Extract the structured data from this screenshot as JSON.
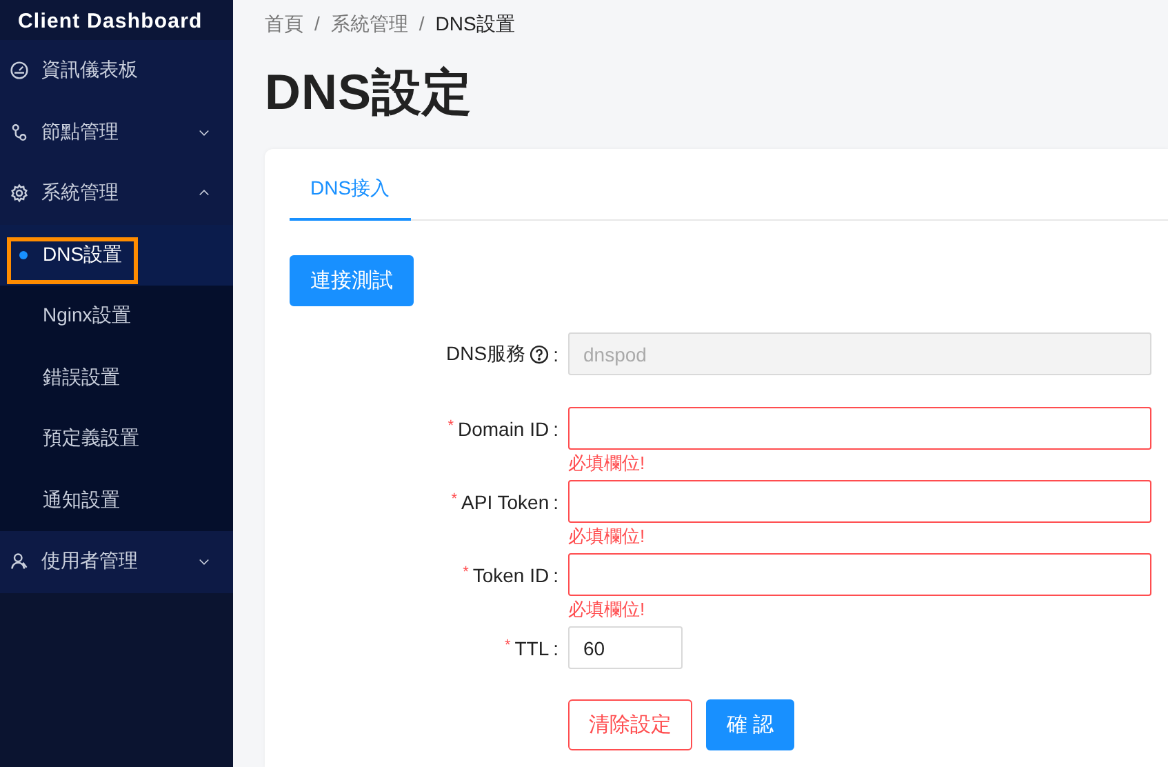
{
  "sidebar": {
    "title": "Client Dashboard",
    "items": [
      {
        "label": "資訊儀表板",
        "kind": "gauge"
      },
      {
        "label": "節點管理",
        "kind": "nodes",
        "expanded": false
      },
      {
        "label": "系統管理",
        "kind": "gear",
        "expanded": true,
        "children": [
          {
            "label": "DNS設置",
            "selected": true,
            "highlighted": true
          },
          {
            "label": "Nginx設置",
            "selected": false,
            "highlighted": false
          },
          {
            "label": "錯誤設置",
            "selected": false,
            "highlighted": false
          },
          {
            "label": "預定義設置",
            "selected": false,
            "highlighted": false
          },
          {
            "label": "通知設置",
            "selected": false,
            "highlighted": false
          }
        ]
      },
      {
        "label": "使用者管理",
        "kind": "users",
        "expanded": false
      }
    ]
  },
  "breadcrumb": [
    {
      "label": "首頁",
      "kind": "link"
    },
    {
      "label": "/",
      "kind": "separator"
    },
    {
      "label": "系統管理",
      "kind": "link"
    },
    {
      "label": "/",
      "kind": "separator"
    },
    {
      "label": "DNS設置",
      "kind": "current"
    }
  ],
  "page_title": "DNS設定",
  "tabs": [
    {
      "label": "DNS接入",
      "selected": true
    }
  ],
  "test_button": "連接測試",
  "form": {
    "fields": [
      {
        "label": "DNS服務",
        "help": true,
        "colon": ":",
        "value": "dnspod",
        "disabled": true,
        "kind": "wide"
      },
      {
        "required_mark": "*",
        "label": "Domain ID",
        "help": false,
        "colon": ":",
        "disabled": false,
        "error": "必填欄位!",
        "kind": "wide"
      },
      {
        "required_mark": "*",
        "label": "API Token",
        "help": false,
        "colon": ":",
        "disabled": false,
        "error": "必填欄位!",
        "kind": "wide"
      },
      {
        "required_mark": "*",
        "label": "Token ID",
        "help": false,
        "colon": ":",
        "disabled": false,
        "error": "必填欄位!",
        "kind": "wide"
      },
      {
        "required_mark": "*",
        "label": "TTL",
        "help": false,
        "colon": ":",
        "value": "60",
        "disabled": false,
        "kind": "narrow"
      }
    ],
    "buttons": [
      {
        "label": "清除設定",
        "kind": "danger"
      },
      {
        "label": "確 認",
        "kind": "primary"
      }
    ]
  }
}
